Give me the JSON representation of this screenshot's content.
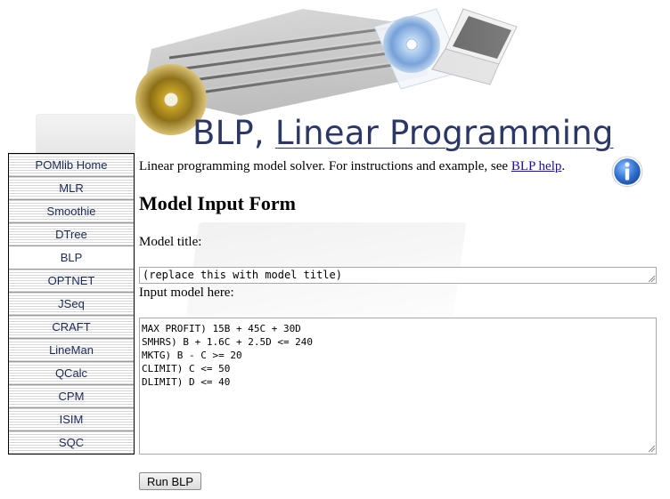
{
  "header": {
    "title_prefix": "BLP, ",
    "title_link": "Linear Programming"
  },
  "sidebar": {
    "items": [
      {
        "label": "POMlib Home"
      },
      {
        "label": "MLR"
      },
      {
        "label": "Smoothie"
      },
      {
        "label": "DTree"
      },
      {
        "label": "BLP",
        "active": true
      },
      {
        "label": "OPTNET"
      },
      {
        "label": "JSeq"
      },
      {
        "label": "CRAFT"
      },
      {
        "label": "LineMan"
      },
      {
        "label": "QCalc"
      },
      {
        "label": "CPM"
      },
      {
        "label": "ISIM"
      },
      {
        "label": "SQC"
      }
    ]
  },
  "intro": {
    "text": "Linear programming model solver. For instructions and example, see ",
    "link": "BLP help",
    "suffix": "."
  },
  "form": {
    "heading": "Model Input Form",
    "title_label": "Model title:",
    "title_value": "(replace this with model title)",
    "model_label": "Input model here:",
    "model_value": "MAX PROFIT) 15B + 45C + 30D\nSMHRS) B + 1.6C + 2.5D <= 240\nMKTG) B - C >= 20\nCLIMIT) C <= 50\nDLIMIT) D <= 40",
    "run_label": "Run BLP"
  },
  "icons": {
    "info": "info-icon",
    "banner": "laptop-cd-banner"
  },
  "colors": {
    "title": "#2b3866",
    "nav_text": "#1c2a5a",
    "link": "#1a0dab",
    "info_blue": "#2f6fd0"
  }
}
